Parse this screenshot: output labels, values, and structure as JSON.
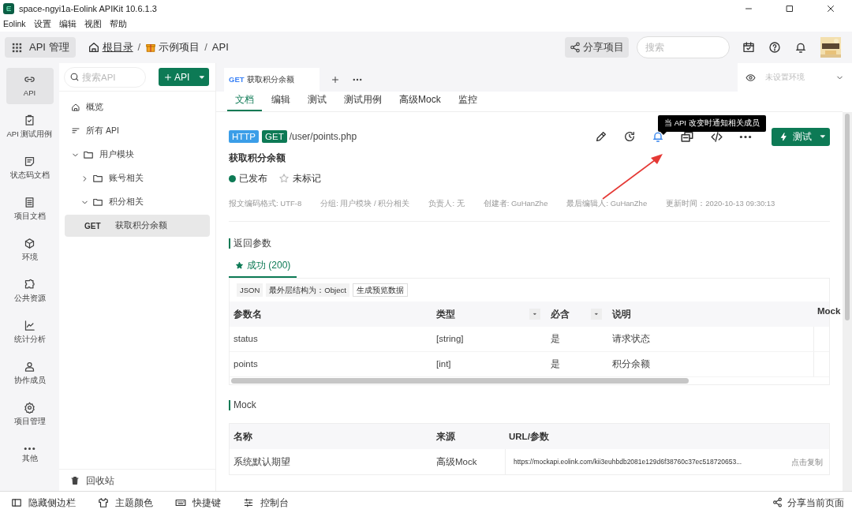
{
  "window": {
    "title": "space-ngyi1a-Eolink APIKit 10.6.1.3"
  },
  "menu_bar": [
    "Eolink",
    "设置",
    "编辑",
    "视图",
    "帮助"
  ],
  "toolbar": {
    "module": "API 管理",
    "breadcrumb": [
      "根目录",
      "示例项目",
      "API"
    ],
    "breadcrumb_separator": "/",
    "share": "分享项目",
    "search": {
      "placeholder": "搜索"
    }
  },
  "nav_rail": [
    {
      "label": "API",
      "selected": true
    },
    {
      "label": "API 测试用例",
      "selected": false
    },
    {
      "label": "状态码文档",
      "selected": false
    },
    {
      "label": "项目文档",
      "selected": false
    },
    {
      "label": "环境",
      "selected": false
    },
    {
      "label": "公共资源",
      "selected": false
    },
    {
      "label": "统计分析",
      "selected": false
    },
    {
      "label": "协作成员",
      "selected": false
    },
    {
      "label": "项目管理",
      "selected": false
    },
    {
      "label": "其他",
      "selected": false
    }
  ],
  "tree_panel": {
    "search": {
      "placeholder": "搜索API"
    },
    "add_button": "API",
    "items": [
      {
        "kind": "overview",
        "label": "概览",
        "selected": false
      },
      {
        "kind": "all",
        "label": "所有 API",
        "selected": false
      },
      {
        "kind": "folder",
        "label": "用户模块",
        "expanded": true,
        "selected": false,
        "children": [
          {
            "kind": "folder",
            "label": "账号相关",
            "expanded": false,
            "selected": false
          },
          {
            "kind": "folder",
            "label": "积分相关",
            "expanded": true,
            "selected": false,
            "children": [
              {
                "kind": "api",
                "method": "GET",
                "label": "获取积分余额",
                "selected": true
              }
            ]
          }
        ]
      }
    ],
    "trash": "回收站"
  },
  "open_tabs": [
    {
      "method": "GET",
      "label": "获取积分余额",
      "selected": true
    }
  ],
  "environment": {
    "placeholder": "未设置环境"
  },
  "doc_tabs": [
    {
      "label": "文档",
      "selected": true
    },
    {
      "label": "编辑",
      "selected": false
    },
    {
      "label": "测试",
      "selected": false
    },
    {
      "label": "测试用例",
      "selected": false
    },
    {
      "label": "高级Mock",
      "selected": false
    },
    {
      "label": "监控",
      "selected": false
    }
  ],
  "tooltip": "当 API 改变时通知相关成员",
  "api": {
    "protocol": "HTTP",
    "method": "GET",
    "path": "/user/points.php",
    "name": "获取积分余额",
    "status": "已发布",
    "starred": false,
    "star_label": "未标记",
    "test_button": "测试",
    "meta": [
      "报文编码格式: UTF-8",
      "分组: 用户模块 / 积分相关",
      "负责人: 无",
      "创建者: GuHanZhe",
      "最后编辑人: GuHanZhe",
      "更新时间：2020-10-13 09:30:13"
    ]
  },
  "return_params": {
    "title": "返回参数",
    "response_tabs": [
      {
        "label": "成功 (200)",
        "selected": true
      }
    ],
    "tags": [
      "JSON",
      "最外层结构为：Object",
      "生成预览数据"
    ],
    "columns": [
      "参数名",
      "类型",
      "必含",
      "说明",
      "Mock"
    ],
    "rows": [
      [
        "status",
        "[string]",
        "是",
        "请求状态",
        ""
      ],
      [
        "points",
        "[int]",
        "是",
        "积分余额",
        ""
      ]
    ]
  },
  "mock": {
    "title": "Mock",
    "columns": [
      "名称",
      "来源",
      "URL/参数"
    ],
    "rows": [
      {
        "name": "系统默认期望",
        "source": "高级Mock",
        "url": "https://mockapi.eolink.com/kii3euhbdb2081e129d6f38760c37ec518720653...",
        "action": "点击复制"
      }
    ]
  },
  "bottom_bar": {
    "items": [
      "隐藏侧边栏",
      "主题颜色",
      "快捷键",
      "控制台"
    ],
    "share": "分享当前页面"
  }
}
